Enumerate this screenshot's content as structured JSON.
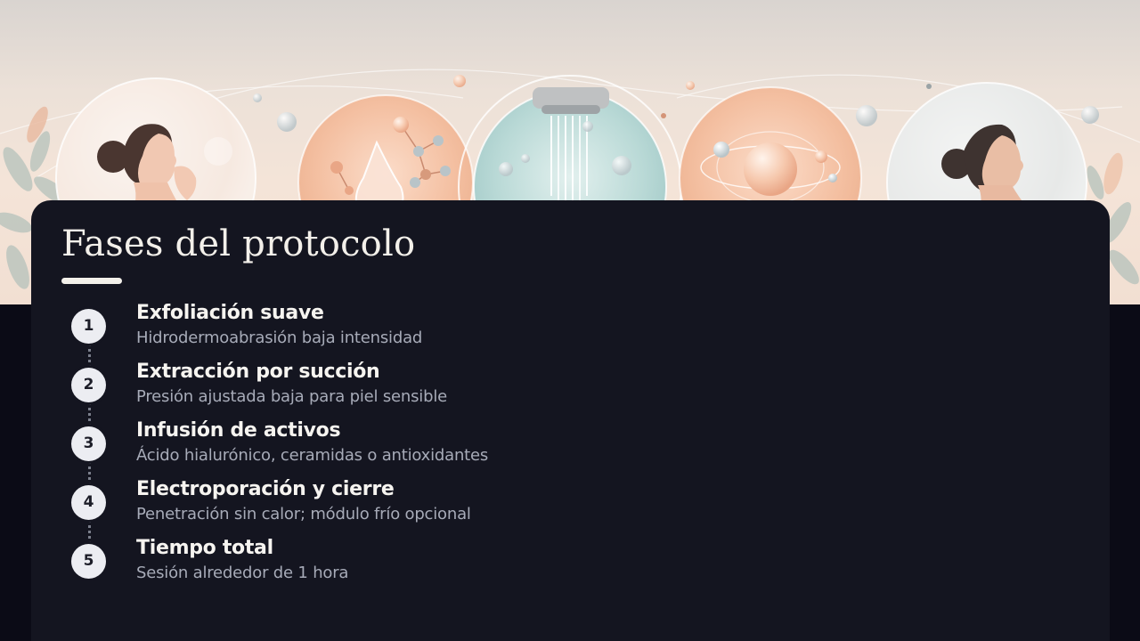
{
  "slide": {
    "title": "Fases del protocolo",
    "steps": [
      {
        "number": "1",
        "title": "Exfoliación suave",
        "description": "Hidrodermoabrasión baja intensidad"
      },
      {
        "number": "2",
        "title": "Extracción por succión",
        "description": "Presión ajustada baja para piel sensible"
      },
      {
        "number": "3",
        "title": "Infusión de activos",
        "description": "Ácido hialurónico, ceramidas o antioxidantes"
      },
      {
        "number": "4",
        "title": "Electroporación y cierre",
        "description": "Penetración sin calor; módulo frío opcional"
      },
      {
        "number": "5",
        "title": "Tiempo total",
        "description": "Sesión alrededor de 1 hora"
      }
    ]
  },
  "colors": {
    "card_background": "#141520",
    "page_background": "#0b0b16",
    "title_text": "#f3f0ea",
    "step_title_text": "#f6f4f0",
    "step_description_text": "#a7abb8",
    "number_badge": "#ecedf2",
    "banner_peach": "#f3c2a6",
    "banner_aqua": "#bcdcd9"
  },
  "banner": {
    "icons": [
      "woman-profile-icon",
      "molecule-droplet-icon",
      "water-shower-sphere-icon",
      "atom-sphere-icon",
      "woman-relaxed-icon",
      "leaf-icon"
    ]
  }
}
